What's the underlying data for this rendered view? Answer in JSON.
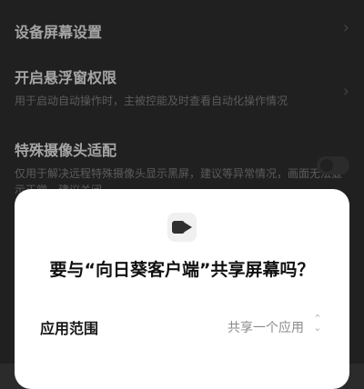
{
  "settings": {
    "item1": {
      "title": "设备屏幕设置"
    },
    "item2": {
      "title": "开启悬浮窗权限",
      "desc": "用于启动自动操作时，主被控能及时查看自动化操作情况"
    },
    "item3": {
      "title": "特殊摄像头适配",
      "desc": "仅用于解决远程特殊摄像头显示黑屏，建议等异常情况，画面无法显示正常，建议关闭"
    }
  },
  "dialog": {
    "icon": "video-camera-icon",
    "title": "要与“向日葵客户端”共享屏幕吗？",
    "scope_label": "应用范围",
    "scope_value": "共享一个应用"
  },
  "colors": {
    "background": "#2b2b2b",
    "sheet": "#ffffff",
    "title": "#111111",
    "muted": "#8a8a8a"
  }
}
